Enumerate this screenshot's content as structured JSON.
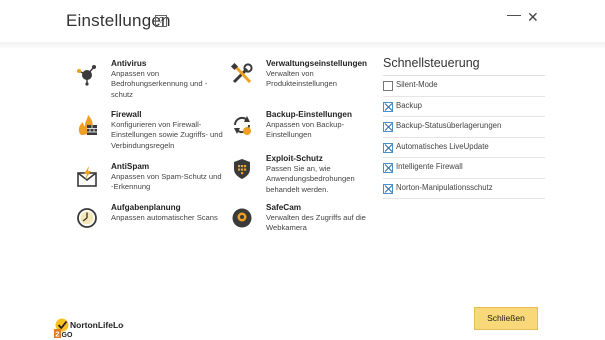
{
  "window": {
    "title": "Einstellungen",
    "help_glyph": "?",
    "min_glyph": "—",
    "close_glyph": "✕"
  },
  "settings": [
    {
      "title": "Antivirus",
      "desc": "Anpassen von Bedrohungserkennung und -schutz",
      "icon": "antivirus-icon"
    },
    {
      "title": "Verwaltungseinstellungen",
      "desc": "Verwalten von Produkteinstellungen",
      "icon": "tools-icon"
    },
    {
      "title": "Firewall",
      "desc": "Konfigurieren von Firewall-Einstellungen sowie Zugriffs- und Verbindungsregeln",
      "icon": "firewall-icon"
    },
    {
      "title": "Backup-Einstellungen",
      "desc": "Anpassen von Backup-Einstellungen",
      "icon": "backup-icon"
    },
    {
      "title": "AntiSpam",
      "desc": "Anpassen von Spam-Schutz und -Erkennung",
      "icon": "antispam-icon"
    },
    {
      "title": "Exploit-Schutz",
      "desc": "Passen Sie an, wie Anwendungsbedrohungen behandelt werden.",
      "icon": "exploit-shield-icon"
    },
    {
      "title": "Aufgabenplanung",
      "desc": "Anpassen automatischer Scans",
      "icon": "clock-icon"
    },
    {
      "title": "SafeCam",
      "desc": "Verwalten des Zugriffs auf die Webkamera",
      "icon": "webcam-icon"
    }
  ],
  "quick_controls": {
    "heading": "Schnellsteuerung",
    "items": [
      {
        "label": "Silent-Mode",
        "checked": false
      },
      {
        "label": "Backup",
        "checked": true
      },
      {
        "label": "Backup-Statusüberlagerungen",
        "checked": true
      },
      {
        "label": "Automatisches LiveUpdate",
        "checked": true
      },
      {
        "label": "Intelligente Firewall",
        "checked": true
      },
      {
        "label": "Norton-Manipulationsschutz",
        "checked": true
      }
    ]
  },
  "brand": {
    "name": "NortonLifeLock",
    "sub": "2GO"
  },
  "footer": {
    "close_label": "Schließen"
  },
  "colors": {
    "accent_yellow": "#f8d878",
    "checkbox_blue": "#2b6ca8",
    "icon_dark": "#3a3a3a",
    "icon_orange": "#f0a020"
  }
}
